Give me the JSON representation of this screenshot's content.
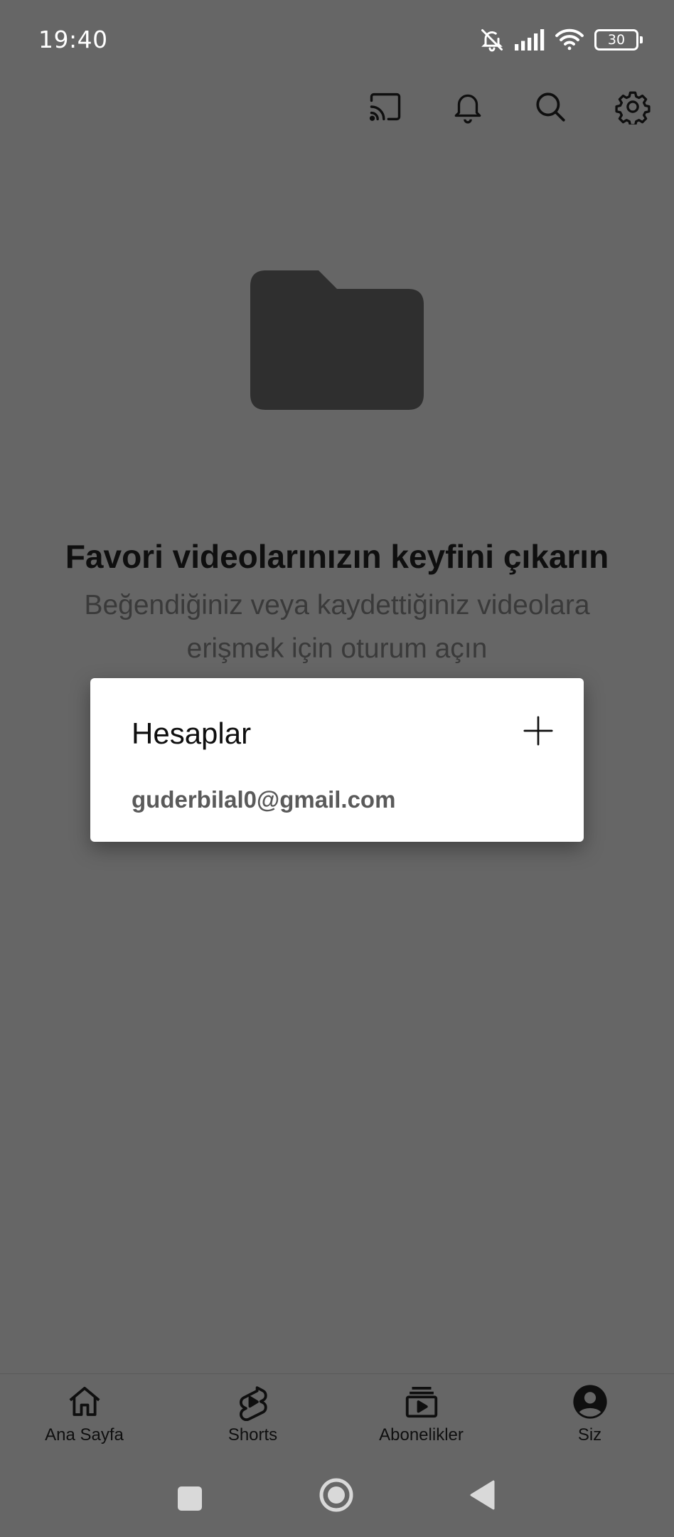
{
  "status_bar": {
    "time": "19:40",
    "battery": "30",
    "icons": [
      "bell-off-icon",
      "signal-icon",
      "wifi-icon",
      "battery-icon"
    ]
  },
  "toolbar": {
    "icons": [
      "cast-icon",
      "bell-icon",
      "search-icon",
      "gear-icon"
    ]
  },
  "empty_state": {
    "icon": "folder-icon",
    "title": "Favori videolarınızın keyfini çıkarın",
    "subtitle": "Beğendiğiniz veya kaydettiğiniz videolara erişmek için oturum açın"
  },
  "accounts_dialog": {
    "title": "Hesaplar",
    "add_icon": "plus-icon",
    "account": "guderbilal0@gmail.com"
  },
  "bottom_nav": {
    "items": [
      {
        "label": "Ana Sayfa",
        "icon": "home-icon"
      },
      {
        "label": "Shorts",
        "icon": "shorts-icon"
      },
      {
        "label": "Abonelikler",
        "icon": "subscriptions-icon"
      },
      {
        "label": "Siz",
        "icon": "account-icon"
      }
    ]
  },
  "system_nav": {
    "icons": [
      "recents-icon",
      "home-circle-icon",
      "back-icon"
    ]
  },
  "colors": {
    "scrim": "#666666",
    "dialog_bg": "#ffffff",
    "text_dark": "#0f0f0f"
  }
}
